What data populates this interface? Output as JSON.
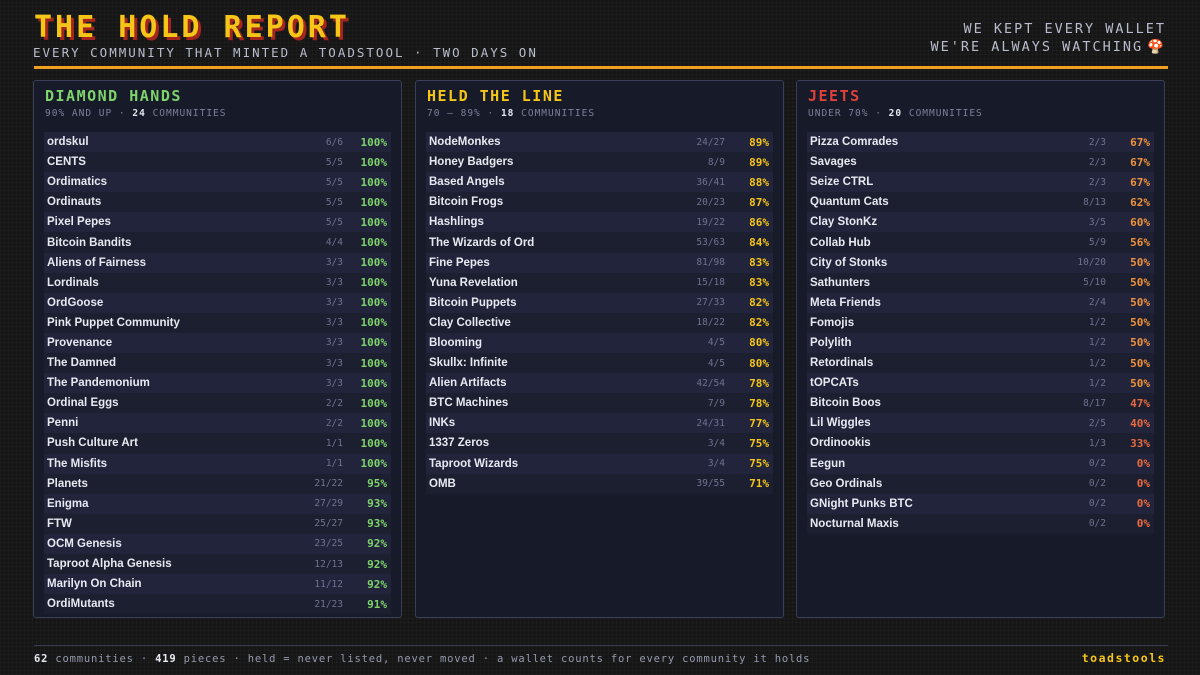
{
  "header": {
    "title": "THE HOLD REPORT",
    "subtitle": "EVERY COMMUNITY THAT MINTED A TOADSTOOL · TWO DAYS ON",
    "tagline_1": "WE KEPT EVERY WALLET",
    "tagline_2": "WE'RE ALWAYS WATCHING",
    "mushroom_icon": "🍄"
  },
  "panels": [
    {
      "title": "DIAMOND HANDS",
      "range": "90% AND UP",
      "count": "24",
      "count_label": "COMMUNITIES",
      "title_color": "#7ed36b",
      "pct_color": "#7ed36b",
      "rows": [
        {
          "name": "ordskul",
          "fraction": "6/6",
          "pct": "100%"
        },
        {
          "name": "CENTS",
          "fraction": "5/5",
          "pct": "100%"
        },
        {
          "name": "Ordimatics",
          "fraction": "5/5",
          "pct": "100%"
        },
        {
          "name": "Ordinauts",
          "fraction": "5/5",
          "pct": "100%"
        },
        {
          "name": "Pixel Pepes",
          "fraction": "5/5",
          "pct": "100%"
        },
        {
          "name": "Bitcoin Bandits",
          "fraction": "4/4",
          "pct": "100%"
        },
        {
          "name": "Aliens of Fairness",
          "fraction": "3/3",
          "pct": "100%"
        },
        {
          "name": "Lordinals",
          "fraction": "3/3",
          "pct": "100%"
        },
        {
          "name": "OrdGoose",
          "fraction": "3/3",
          "pct": "100%"
        },
        {
          "name": "Pink Puppet Community",
          "fraction": "3/3",
          "pct": "100%"
        },
        {
          "name": "Provenance",
          "fraction": "3/3",
          "pct": "100%"
        },
        {
          "name": "The Damned",
          "fraction": "3/3",
          "pct": "100%"
        },
        {
          "name": "The Pandemonium",
          "fraction": "3/3",
          "pct": "100%"
        },
        {
          "name": "Ordinal Eggs",
          "fraction": "2/2",
          "pct": "100%"
        },
        {
          "name": "Penni",
          "fraction": "2/2",
          "pct": "100%"
        },
        {
          "name": "Push Culture Art",
          "fraction": "1/1",
          "pct": "100%"
        },
        {
          "name": "The Misfits",
          "fraction": "1/1",
          "pct": "100%"
        },
        {
          "name": "Planets",
          "fraction": "21/22",
          "pct": "95%"
        },
        {
          "name": "Enigma",
          "fraction": "27/29",
          "pct": "93%"
        },
        {
          "name": "FTW",
          "fraction": "25/27",
          "pct": "93%"
        },
        {
          "name": "OCM Genesis",
          "fraction": "23/25",
          "pct": "92%"
        },
        {
          "name": "Taproot Alpha Genesis",
          "fraction": "12/13",
          "pct": "92%"
        },
        {
          "name": "Marilyn On Chain",
          "fraction": "11/12",
          "pct": "92%"
        },
        {
          "name": "OrdiMutants",
          "fraction": "21/23",
          "pct": "91%"
        }
      ]
    },
    {
      "title": "HELD THE LINE",
      "range": "70 – 89%",
      "count": "18",
      "count_label": "COMMUNITIES",
      "title_color": "#f5c518",
      "pct_color": "#f5c518",
      "rows": [
        {
          "name": "NodeMonkes",
          "fraction": "24/27",
          "pct": "89%"
        },
        {
          "name": "Honey Badgers",
          "fraction": "8/9",
          "pct": "89%"
        },
        {
          "name": "Based Angels",
          "fraction": "36/41",
          "pct": "88%"
        },
        {
          "name": "Bitcoin Frogs",
          "fraction": "20/23",
          "pct": "87%"
        },
        {
          "name": "Hashlings",
          "fraction": "19/22",
          "pct": "86%"
        },
        {
          "name": "The Wizards of Ord",
          "fraction": "53/63",
          "pct": "84%"
        },
        {
          "name": "Fine Pepes",
          "fraction": "81/98",
          "pct": "83%"
        },
        {
          "name": "Yuna Revelation",
          "fraction": "15/18",
          "pct": "83%"
        },
        {
          "name": "Bitcoin Puppets",
          "fraction": "27/33",
          "pct": "82%"
        },
        {
          "name": "Clay Collective",
          "fraction": "18/22",
          "pct": "82%"
        },
        {
          "name": "Blooming",
          "fraction": "4/5",
          "pct": "80%"
        },
        {
          "name": "Skullx: Infinite",
          "fraction": "4/5",
          "pct": "80%"
        },
        {
          "name": "Alien Artifacts",
          "fraction": "42/54",
          "pct": "78%"
        },
        {
          "name": "BTC Machines",
          "fraction": "7/9",
          "pct": "78%"
        },
        {
          "name": "INKs",
          "fraction": "24/31",
          "pct": "77%"
        },
        {
          "name": "1337 Zeros",
          "fraction": "3/4",
          "pct": "75%"
        },
        {
          "name": "Taproot Wizards",
          "fraction": "3/4",
          "pct": "75%"
        },
        {
          "name": "OMB",
          "fraction": "39/55",
          "pct": "71%"
        }
      ]
    },
    {
      "title": "JEETS",
      "range": "UNDER 70%",
      "count": "20",
      "count_label": "COMMUNITIES",
      "title_color": "#e0403a",
      "pct_color": "#f0923a",
      "low_pct_color": "#ea6a40",
      "rows": [
        {
          "name": "Pizza Comrades",
          "fraction": "2/3",
          "pct": "67%"
        },
        {
          "name": "Savages",
          "fraction": "2/3",
          "pct": "67%"
        },
        {
          "name": "Seize CTRL",
          "fraction": "2/3",
          "pct": "67%"
        },
        {
          "name": "Quantum Cats",
          "fraction": "8/13",
          "pct": "62%"
        },
        {
          "name": "Clay StonKz",
          "fraction": "3/5",
          "pct": "60%"
        },
        {
          "name": "Collab Hub",
          "fraction": "5/9",
          "pct": "56%"
        },
        {
          "name": "City of Stonks",
          "fraction": "10/20",
          "pct": "50%"
        },
        {
          "name": "Sathunters",
          "fraction": "5/10",
          "pct": "50%"
        },
        {
          "name": "Meta Friends",
          "fraction": "2/4",
          "pct": "50%"
        },
        {
          "name": "Fomojis",
          "fraction": "1/2",
          "pct": "50%"
        },
        {
          "name": "Polylith",
          "fraction": "1/2",
          "pct": "50%"
        },
        {
          "name": "Retordinals",
          "fraction": "1/2",
          "pct": "50%"
        },
        {
          "name": "tOPCATs",
          "fraction": "1/2",
          "pct": "50%"
        },
        {
          "name": "Bitcoin Boos",
          "fraction": "8/17",
          "pct": "47%",
          "low": true
        },
        {
          "name": "Lil Wiggles",
          "fraction": "2/5",
          "pct": "40%",
          "low": true
        },
        {
          "name": "Ordinookis",
          "fraction": "1/3",
          "pct": "33%",
          "low": true
        },
        {
          "name": "Eegun",
          "fraction": "0/2",
          "pct": "0%",
          "low": true
        },
        {
          "name": "Geo Ordinals",
          "fraction": "0/2",
          "pct": "0%",
          "low": true
        },
        {
          "name": "GNight Punks BTC",
          "fraction": "0/2",
          "pct": "0%",
          "low": true
        },
        {
          "name": "Nocturnal Maxis",
          "fraction": "0/2",
          "pct": "0%",
          "low": true
        }
      ]
    }
  ],
  "footer": {
    "communities_count": "62",
    "communities_label": "communities",
    "pieces_count": "419",
    "pieces_label": "pieces",
    "note": "held = never listed, never moved · a wallet counts for every community it holds",
    "brand": "toadstools"
  }
}
